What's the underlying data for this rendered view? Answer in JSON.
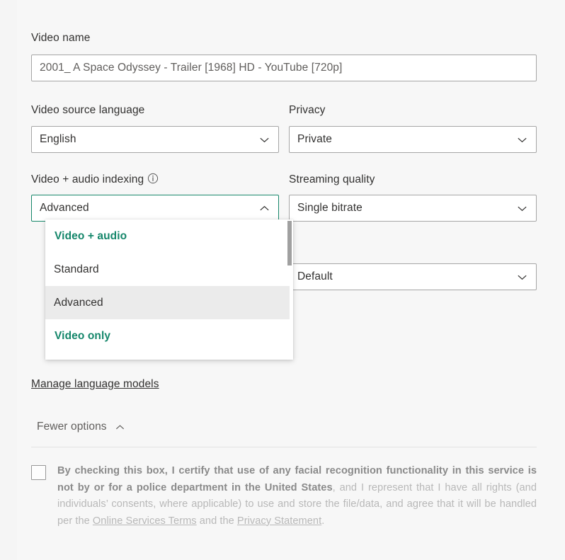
{
  "form": {
    "video_name": {
      "label": "Video name",
      "value": "2001_  A Space Odyssey - Trailer [1968] HD - YouTube [720p]",
      "placeholder": "Video name"
    },
    "video_source_language": {
      "label": "Video source language",
      "value": "English"
    },
    "privacy": {
      "label": "Privacy",
      "value": "Private"
    },
    "video_audio_indexing": {
      "label": "Video + audio indexing",
      "value": "Advanced",
      "info_icon": "info-icon",
      "expanded": true,
      "options": [
        {
          "label": "Video + audio",
          "type": "group-header",
          "selected": false
        },
        {
          "label": "Standard",
          "type": "option",
          "selected": false
        },
        {
          "label": "Advanced",
          "type": "option",
          "selected": true
        },
        {
          "label": "Video only",
          "type": "group-header",
          "selected": false
        }
      ]
    },
    "streaming_quality": {
      "label": "Streaming quality",
      "value": "Single bitrate"
    },
    "extra_select": {
      "label": "",
      "value": "Default"
    },
    "manage_language_models_link": "Manage language models",
    "fewer_options": {
      "label": "Fewer options",
      "icon": "chevron-up-icon"
    }
  },
  "disclaimer": {
    "bold_part": "By checking this box, I certify that use of any facial recognition functionality in this service is not by or for a police department in the United States",
    "rest_part_1": ", and I represent that I have all rights (and individuals’ consents, where applicable) to use and store the file/data, and agree that it will be handled per the ",
    "link_1": "Online Services Terms",
    "mid_part": " and the ",
    "link_2": "Privacy Statement",
    "end_part": "."
  },
  "colors": {
    "accent_teal": "#14866a",
    "text_primary": "#323130",
    "text_secondary": "#605e5c",
    "disclaimer_muted": "#b8b8b8",
    "border": "#a6a6a6",
    "selected_row": "#ebebeb",
    "page_background": "#f7f7f7"
  }
}
